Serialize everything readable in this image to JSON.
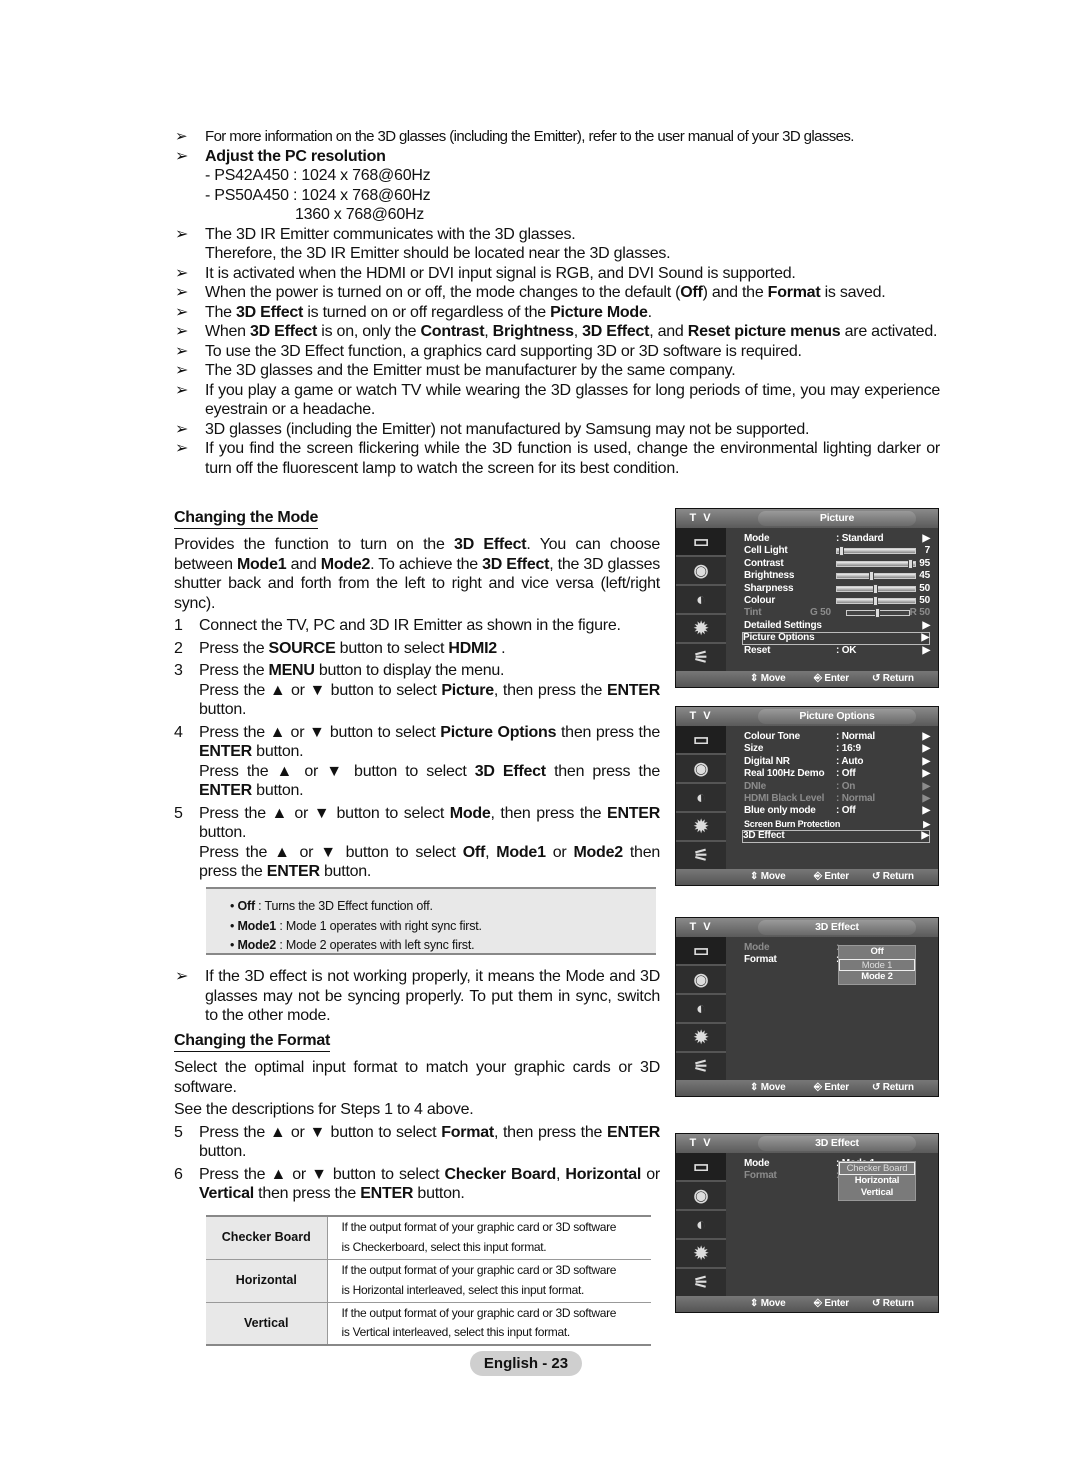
{
  "top_notes": [
    {
      "small": true,
      "segs": [
        "For more information on the 3D glasses (including the Emitter), refer to the user manual of your 3D glasses."
      ]
    },
    {
      "segs": [
        {
          "b": "Adjust the PC resolution"
        }
      ],
      "sub": [
        "- PS42A450 : 1024 x 768@60Hz",
        "- PS50A450 : 1024 x 768@60Hz",
        "1360 x 768@60Hz"
      ]
    },
    {
      "segs": [
        "The 3D IR Emitter communicates with the 3D glasses."
      ],
      "sub": [
        "Therefore, the 3D IR Emitter should be located near the 3D glasses."
      ]
    },
    {
      "segs": [
        "It is activated when the HDMI or DVI input signal is RGB, and DVI Sound is supported."
      ]
    },
    {
      "segs": [
        "When the power is turned on or off, the mode changes to the default (",
        {
          "b": "Off"
        },
        ") and the ",
        {
          "b": "Format"
        },
        " is saved."
      ]
    },
    {
      "segs": [
        "The ",
        {
          "b": "3D Effect"
        },
        " is turned on or off regardless of the ",
        {
          "b": "Picture Mode"
        },
        "."
      ]
    },
    {
      "segs": [
        "When ",
        {
          "b": "3D Effect"
        },
        " is on, only the ",
        {
          "b": "Contrast"
        },
        ", ",
        {
          "b": "Brightness"
        },
        ", ",
        {
          "b": "3D Effect"
        },
        ", and ",
        {
          "b": "Reset picture menus"
        },
        " are activated."
      ]
    },
    {
      "segs": [
        "To use the 3D Effect function, a graphics card supporting 3D or 3D software is required."
      ]
    },
    {
      "segs": [
        "The 3D glasses and the Emitter must be manufacturer by the same company."
      ]
    },
    {
      "segs": [
        "If you play a game or watch TV while wearing the 3D glasses for long periods of time, you may experience eyestrain or a headache."
      ]
    },
    {
      "segs": [
        "3D glasses (including the Emitter) not manufactured by Samsung may not be supported."
      ]
    },
    {
      "segs": [
        "If you find the screen flickering while the 3D function is used, change the environmental lighting darker or turn off the fluorescent lamp to watch the screen for its best condition."
      ]
    }
  ],
  "arrow_glyph": "➢",
  "mode_section": {
    "heading": "Changing the Mode",
    "intro": [
      "Provides the function to turn on the ",
      {
        "b": "3D Effect"
      },
      ". You can choose between ",
      {
        "b": "Mode1"
      },
      " and ",
      {
        "b": "Mode2"
      },
      ". To achieve the ",
      {
        "b": "3D Effect"
      },
      ", the 3D glasses shutter back and forth from the left to right and vice versa (left/right sync)."
    ],
    "steps": [
      {
        "num": "1",
        "paras": [
          [
            "Connect the TV, PC and 3D IR Emitter as shown in the figure."
          ]
        ]
      },
      {
        "num": "2",
        "paras": [
          [
            "Press the ",
            {
              "b": "SOURCE"
            },
            " button to select ",
            {
              "b": "HDMI2"
            },
            " ."
          ]
        ]
      },
      {
        "num": "3",
        "paras": [
          [
            "Press the ",
            {
              "b": "MENU"
            },
            " button to display the menu."
          ],
          [
            "Press the ▲ or ▼ button to select ",
            {
              "b": "Picture"
            },
            ", then press the ",
            {
              "b": "ENTER"
            },
            " button."
          ]
        ]
      },
      {
        "num": "4",
        "paras": [
          [
            "Press the ▲ or ▼ button to select ",
            {
              "b": "Picture Options"
            },
            " then press the ",
            {
              "b": "ENTER"
            },
            " button."
          ],
          [
            "Press the ▲ or ▼ button to select ",
            {
              "b": "3D Effect"
            },
            " then press the ",
            {
              "b": "ENTER"
            },
            " button."
          ]
        ]
      },
      {
        "num": "5",
        "paras": [
          [
            "Press the ▲ or ▼ button to select ",
            {
              "b": "Mode"
            },
            ", then press the ",
            {
              "b": "ENTER"
            },
            " button."
          ],
          [
            "Press the ▲ or ▼ button to select ",
            {
              "b": "Off"
            },
            ", ",
            {
              "b": "Mode1"
            },
            " or ",
            {
              "b": "Mode2"
            },
            " then press the ",
            {
              "b": "ENTER"
            },
            " button."
          ]
        ]
      }
    ],
    "options_box": [
      {
        "term": "Off",
        "desc": " : Turns the 3D Effect function off."
      },
      {
        "term": "Mode1",
        "desc": " : Mode 1 operates with right sync first."
      },
      {
        "term": "Mode2",
        "desc": " : Mode 2 operates with left sync first."
      }
    ],
    "sync_note": "If the 3D effect is not working properly, it means the Mode and 3D glasses may not be syncing properly. To put them in sync, switch to the other mode."
  },
  "format_section": {
    "heading": "Changing the Format",
    "intro": "Select the optimal input format to match your graphic cards or 3D software.",
    "see": "See the descriptions for Steps 1 to 4 above.",
    "steps": [
      {
        "num": "5",
        "paras": [
          [
            "Press the ▲ or ▼ button to select ",
            {
              "b": "Format"
            },
            ", then press the ",
            {
              "b": "ENTER"
            },
            " button."
          ]
        ]
      },
      {
        "num": "6",
        "paras": [
          [
            "Press the ▲ or ▼ button to select ",
            {
              "b": "Checker Board"
            },
            ", ",
            {
              "b": "Horizontal"
            },
            " or ",
            {
              "b": "Vertical"
            },
            " then press the ",
            {
              "b": "ENTER"
            },
            " button."
          ]
        ]
      }
    ],
    "table": [
      {
        "format": "Checker Board",
        "desc": [
          "If the output format of your graphic card or 3D software",
          "is Checkerboard, select this input format."
        ]
      },
      {
        "format": "Horizontal",
        "desc": [
          "If the output format of your graphic card or 3D software",
          "is Horizontal interleaved, select this input format."
        ]
      },
      {
        "format": "Vertical",
        "desc": [
          "If the output format of your graphic card or 3D software",
          "is Vertical interleaved, select this input format."
        ]
      }
    ]
  },
  "page_label": "English - 23",
  "tv_menus": [
    {
      "tv": "T V",
      "title": "Picture",
      "footer": {
        "move": "⇕ Move",
        "enter": "⎆ Enter",
        "return": "↺ Return"
      },
      "rows": [
        {
          "label": "Mode",
          "value": ": Standard",
          "arrow": "▶"
        },
        {
          "label": "Cell Light",
          "slider": 7,
          "num": "7"
        },
        {
          "label": "Contrast",
          "slider": 95,
          "num": "95"
        },
        {
          "label": "Brightness",
          "slider": 45,
          "num": "45"
        },
        {
          "label": "Sharpness",
          "slider": 50,
          "num": "50"
        },
        {
          "label": "Colour",
          "slider": 50,
          "num": "50"
        },
        {
          "label": "Tint",
          "slider": 50,
          "left": "G  50",
          "num": "R  50",
          "dim": true
        },
        {
          "label": "Detailed Settings",
          "arrow": "▶"
        },
        {
          "label": "Picture Options",
          "arrow": "▶",
          "highlight": true
        },
        {
          "label": "Reset",
          "value": ": OK",
          "arrow": "▶"
        }
      ]
    },
    {
      "tv": "T V",
      "title": "Picture Options",
      "footer": {
        "move": "⇕ Move",
        "enter": "⎆ Enter",
        "return": "↺ Return"
      },
      "rows": [
        {
          "label": "Colour Tone",
          "value": ": Normal",
          "arrow": "▶"
        },
        {
          "label": "Size",
          "value": ": 16:9",
          "arrow": "▶"
        },
        {
          "label": "Digital NR",
          "value": ": Auto",
          "arrow": "▶"
        },
        {
          "label": "Real 100Hz Demo",
          "value": ": Off",
          "arrow": "▶"
        },
        {
          "label": "DNIe",
          "value": ": On",
          "arrow": "▶",
          "dim": true
        },
        {
          "label": "HDMI Black Level",
          "value": ": Normal",
          "arrow": "▶",
          "dim": true
        },
        {
          "label": "Blue only mode",
          "value": ": Off",
          "arrow": "▶"
        },
        {
          "label": "Screen Burn Protection",
          "arrow": "▶",
          "small": true
        },
        {
          "label": "3D Effect",
          "arrow": "▶",
          "highlight": true
        }
      ]
    },
    {
      "tv": "T V",
      "title": "3D Effect",
      "footer": {
        "move": "⇕ Move",
        "enter": "⎆ Enter",
        "return": "↺ Return"
      },
      "rows": [
        {
          "label": "Mode",
          "value": ":",
          "dim": true
        },
        {
          "label": "Format",
          "value": ":"
        }
      ],
      "popup": {
        "options": [
          "Off",
          "Mode 1",
          "Mode 2"
        ],
        "selected": "Mode 1"
      }
    },
    {
      "tv": "T V",
      "title": "3D Effect",
      "footer": {
        "move": "⇕ Move",
        "enter": "⎆ Enter",
        "return": "↺ Return"
      },
      "rows": [
        {
          "label": "Mode",
          "value": ": Mode 1"
        },
        {
          "label": "Format",
          "value": ":",
          "dim": true
        }
      ],
      "popup": {
        "options": [
          "Checker Board",
          "Horizontal",
          "Vertical"
        ],
        "selected": "Checker Board"
      }
    }
  ],
  "sidebar_icons": [
    "picture-icon",
    "sound-icon",
    "channel-icon",
    "setup-icon",
    "input-icon"
  ]
}
